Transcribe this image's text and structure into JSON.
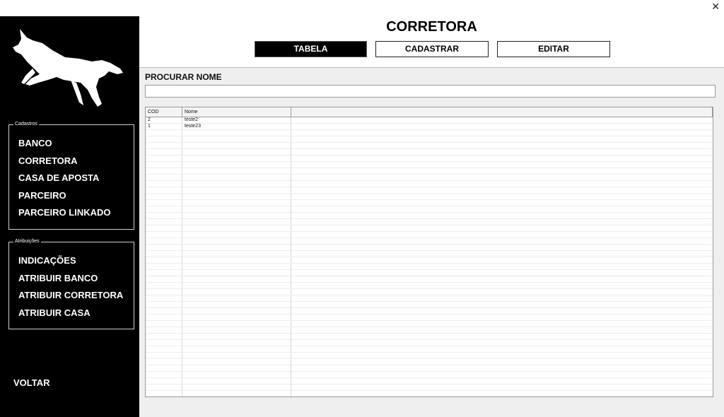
{
  "window": {
    "close_glyph": "✕"
  },
  "sidebar": {
    "logo_icon": "fox-logo",
    "groups": [
      {
        "legend": "Cadastros",
        "items": [
          "BANCO",
          "CORRETORA",
          "CASA DE APOSTA",
          "PARCEIRO",
          "PARCEIRO LINKADO"
        ]
      },
      {
        "legend": "Atribuições",
        "items": [
          "INDICAÇÕES",
          "ATRIBUIR BANCO",
          "ATRIBUIR CORRETORA",
          "ATRIBUIR CASA"
        ]
      }
    ],
    "voltar": "VOLTAR"
  },
  "header": {
    "title": "CORRETORA",
    "tabs": [
      {
        "label": "TABELA",
        "active": true
      },
      {
        "label": "CADASTRAR",
        "active": false
      },
      {
        "label": "EDITAR",
        "active": false
      }
    ]
  },
  "search": {
    "label": "PROCURAR NOME",
    "value": ""
  },
  "table": {
    "columns": [
      "COD",
      "Nome"
    ],
    "rows": [
      [
        "2",
        "teste2"
      ],
      [
        "1",
        "teste23"
      ]
    ]
  },
  "colors": {
    "sidebar_bg": "#000000",
    "content_bg": "#efefef",
    "accent": "#000000"
  }
}
